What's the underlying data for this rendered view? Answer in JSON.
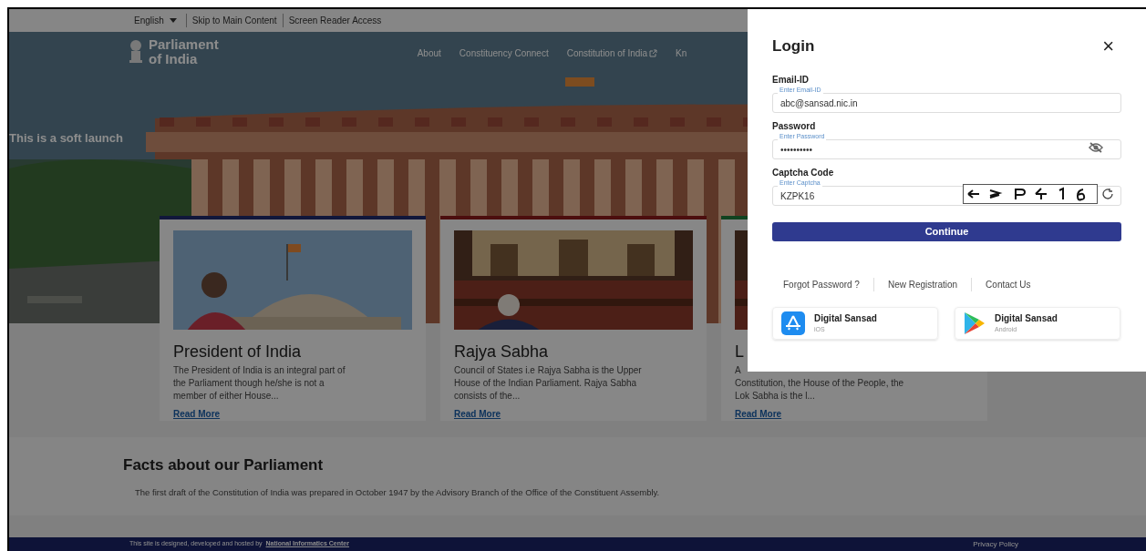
{
  "top_bar": {
    "language": "English",
    "links": [
      "Skip to Main Content",
      "Screen Reader Access"
    ]
  },
  "header": {
    "logo_lines": [
      "Parliament",
      "of India"
    ],
    "nav": [
      {
        "label": "About",
        "external": false
      },
      {
        "label": "Constituency Connect",
        "external": false
      },
      {
        "label": "Constitution of India",
        "external": true
      },
      {
        "label": "Kn",
        "external": false
      }
    ]
  },
  "hero": {
    "banner": "This is a soft launch"
  },
  "cards": [
    {
      "kind": "president",
      "color": "#11173b",
      "title": "President of India",
      "lines": [
        "The President of India is an integral part of",
        "the Parliament though he/she is not a",
        "member of either House..."
      ],
      "link": "Read More"
    },
    {
      "kind": "chamber",
      "color": "#4c0e0e",
      "title": "Rajya Sabha",
      "lines": [
        "Council of States i.e Rajya Sabha is the Upper",
        "House of the Indian Parliament. Rajya Sabha",
        "consists of the..."
      ],
      "link": "Read More"
    },
    {
      "kind": "chamber",
      "color": "#114320",
      "title": "L",
      "lines": [
        "A",
        "Constitution, the House of the People, the",
        "Lok Sabha is the l..."
      ],
      "link": "Read More"
    }
  ],
  "facts": {
    "title": "Facts about our Parliament",
    "text": "The first draft of the Constitution of India was prepared in October 1947 by the Advisory Branch of the Office of the Constituent Assembly."
  },
  "footer": {
    "text": "This site is designed, developed and hosted by",
    "link": "National Informatics Center",
    "privacy": "Privacy Policy"
  },
  "login": {
    "title": "Login",
    "close": "×",
    "fields": [
      {
        "kind": "text",
        "label": "Email-ID",
        "placeholder": "Enter Email-ID",
        "value": "abc@sansad.nic.in"
      },
      {
        "kind": "password",
        "label": "Password",
        "placeholder": "Enter Password",
        "value": "••••••••••"
      },
      {
        "kind": "captcha",
        "label": "Captcha Code",
        "placeholder": "Enter Captcha",
        "value": "KZPK16"
      }
    ],
    "button": "Continue",
    "links": [
      "Forgot Password ?",
      "New Registration",
      "Contact Us"
    ],
    "apps": [
      {
        "kind": "ios",
        "name": "Digital Sansad",
        "platform": "iOS"
      },
      {
        "kind": "android",
        "name": "Digital Sansad",
        "platform": "Android"
      }
    ]
  }
}
